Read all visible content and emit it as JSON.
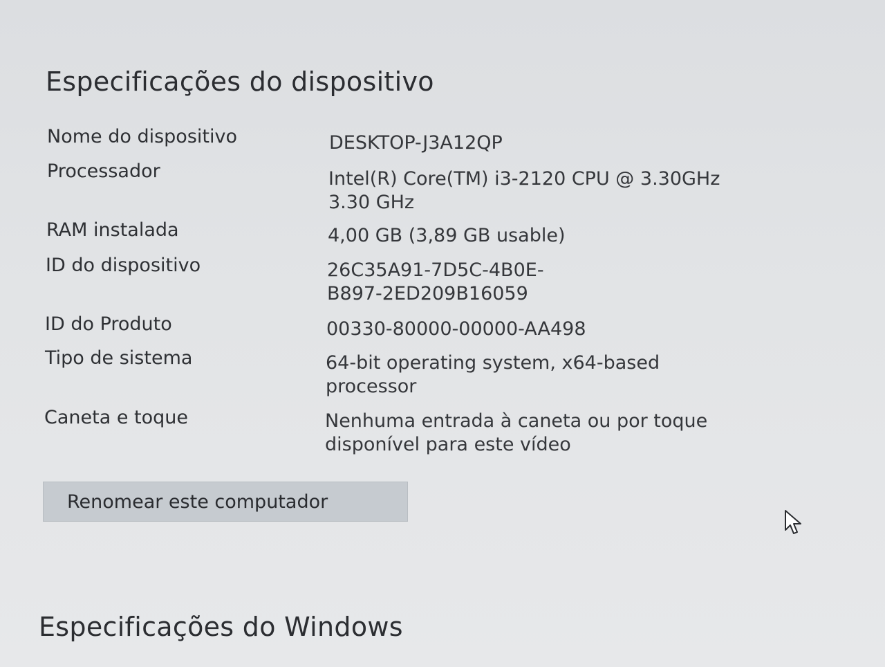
{
  "device_specs": {
    "title": "Especificações do dispositivo",
    "rows": [
      {
        "label": "Nome do dispositivo",
        "lines": [
          "DESKTOP-J3A12QP"
        ]
      },
      {
        "label": "Processador",
        "lines": [
          "Intel(R) Core(TM) i3-2120 CPU @ 3.30GHz",
          "3.30 GHz"
        ]
      },
      {
        "label": "RAM instalada",
        "lines": [
          "4,00 GB (3,89 GB usable)"
        ]
      },
      {
        "label": "ID do dispositivo",
        "lines": [
          "26C35A91-7D5C-4B0E-",
          "B897-2ED209B16059"
        ]
      },
      {
        "label": "ID do Produto",
        "lines": [
          "00330-80000-00000-AA498"
        ]
      },
      {
        "label": "Tipo de sistema",
        "lines": [
          "64-bit operating system, x64-based",
          "processor"
        ]
      },
      {
        "label": "Caneta e toque",
        "lines": [
          "Nenhuma entrada à caneta ou por toque",
          "disponível para este vídeo"
        ]
      }
    ],
    "rename_button": "Renomear este computador"
  },
  "windows_specs": {
    "title": "Especificações do Windows"
  },
  "icons": {
    "pointer": "mouse-pointer-icon"
  }
}
